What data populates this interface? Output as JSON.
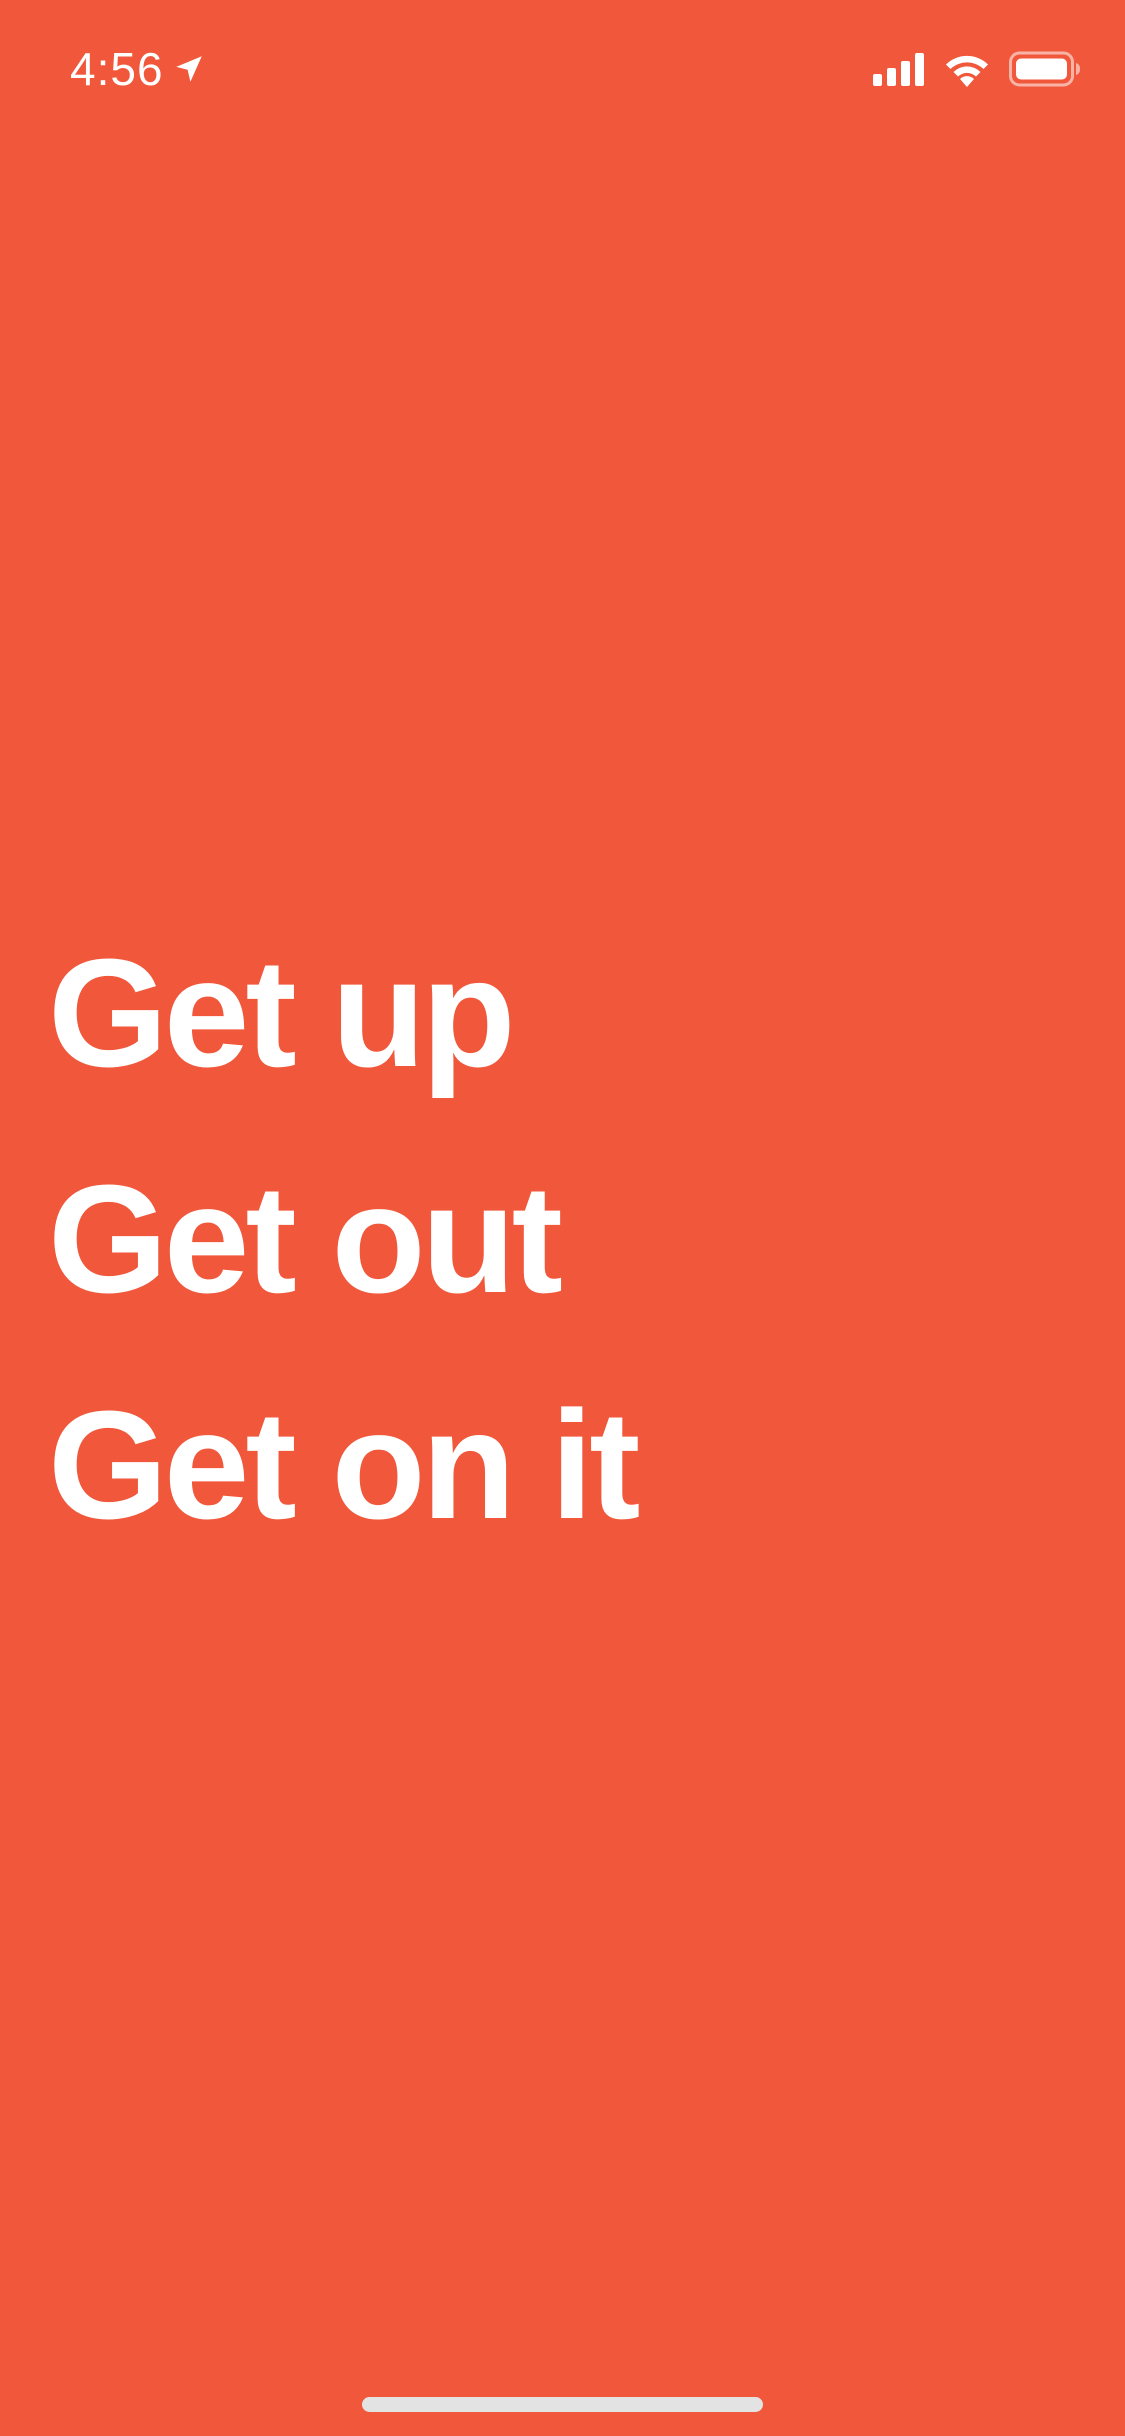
{
  "status_bar": {
    "time": "4:56",
    "icons": [
      "location-arrow-icon",
      "cellular-signal-icon",
      "wifi-icon",
      "battery-icon"
    ]
  },
  "headline": {
    "lines": [
      "Get up",
      "Get out",
      "Get on it"
    ]
  },
  "colors": {
    "background": "#F0573B",
    "text": "#FFFFFF",
    "home_indicator": "#E3E3E3"
  }
}
